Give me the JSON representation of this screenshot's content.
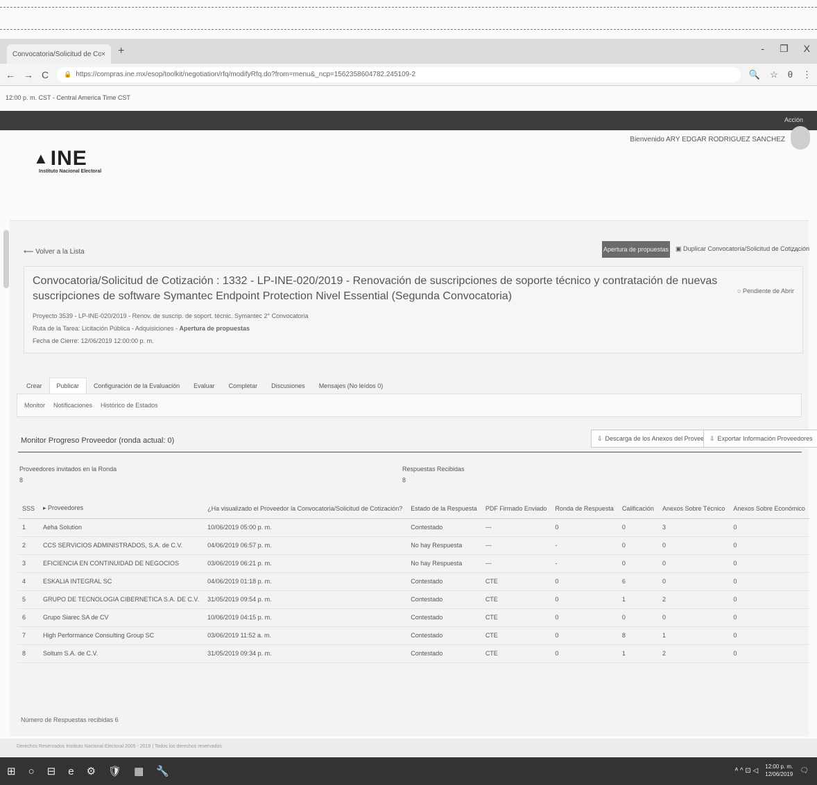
{
  "browser": {
    "tab_title": "Convocatoria/Solicitud de Coti",
    "close_glyph": "×",
    "new_tab_glyph": "+",
    "window_controls": [
      "-",
      "❐",
      "X"
    ],
    "back_glyph": "←",
    "forward_glyph": "→",
    "reload_glyph": "C",
    "lock_glyph": "🔒",
    "url": "https://compras.ine.mx/esop/toolkit/negotiation/rfq/modifyRfq.do?from=menu&_ncp=1562358604782.245109-2",
    "right_icons": [
      "🔍",
      "☆",
      "θ",
      "⋮"
    ]
  },
  "site": {
    "timezone": "12:00 p. m. CST - Central America Time CST",
    "darkbar_right": "Acción",
    "welcome": "Bienvenido ARY EDGAR RODRIGUEZ SANCHEZ",
    "logo_text": "INE",
    "logo_symbol": "▲",
    "logo_sub": "Instituto Nacional Electoral",
    "back_link": "Volver a la Lista",
    "back_glyph": "⟵",
    "btn_open": "Apertura de propuestas",
    "btn_duplicate": "Duplicar Convocatoria/Solicitud de Cotización",
    "btn_more": "...",
    "title": "Convocatoria/Solicitud de Cotización : 1332 - LP-INE-020/2019 - Renovación de suscripciones de soporte técnico y contratación de nuevas suscripciones de software Symantec Endpoint Protection Nivel Essential (Segunda Convocatoria)",
    "status": "Pendiente de Abrir",
    "meta1": "Proyecto 3539 - LP-INE-020/2019 - Renov. de suscrip. de soport. técnic. Symantec 2° Convocatoria",
    "meta2_label": "Ruta de la Tarea: Licitación Pública - Adquisiciones - ",
    "meta2_value": "Apertura de propuestas",
    "meta3": "Fecha de Cierre: 12/06/2019 12:00:00 p. m.",
    "tabs": [
      "Crear",
      "Publicar",
      "Configuración de la Evaluación",
      "Evaluar",
      "Completar",
      "Discusiones",
      "Mensajes (No leídos 0)"
    ],
    "subtabs": [
      "Monitor",
      "Notificaciones",
      "Histórico de Estados"
    ],
    "section_title": "Monitor Progreso Proveedor (ronda actual: 0)",
    "btn_download": "Descarga de los Anexos del Proveedor",
    "btn_export": "Exportar Información Proveedores",
    "invited_label": "Proveedores invitados en la Ronda",
    "invited_count": "8",
    "received_label": "Respuestas Recibidas",
    "received_count": "8",
    "footnote": "Número de Respuestas recibidas 6",
    "footer_text": "Derechos Reservados Instituto Nacional Electoral 2005 - 2019 | Todos los derechos reservados"
  },
  "table": {
    "headers": [
      "SSS",
      "▸ Proveedores",
      "¿Ha visualizado el Proveedor la Convocatoria/Solicitud de Cotización?",
      "Estado de la Respuesta",
      "PDF Firmado Enviado",
      "Ronda de Respuesta",
      "Calificación",
      "Anexos Sobre Técnico",
      "Anexos Sobre Económico"
    ],
    "rows": [
      [
        "1",
        "Aeha Solution",
        "10/06/2019 05:00 p. m.",
        "Contestado",
        "---",
        "0",
        "0",
        "3",
        "0"
      ],
      [
        "2",
        "CCS SERVICIOS ADMINISTRADOS, S.A. de C.V.",
        "04/06/2019 06:57 p. m.",
        "No hay Respuesta",
        "---",
        "-",
        "0",
        "0",
        "0"
      ],
      [
        "3",
        "EFICIENCIA EN CONTINUIDAD DE NEGOCIOS",
        "03/06/2019 06:21 p. m.",
        "No hay Respuesta",
        "---",
        "-",
        "0",
        "0",
        "0"
      ],
      [
        "4",
        "ESKALIA INTEGRAL SC",
        "04/06/2019 01:18 p. m.",
        "Contestado",
        "CTE",
        "0",
        "6",
        "0",
        "0"
      ],
      [
        "5",
        "GRUPO DE TECNOLOGIA CIBERNETICA S.A. DE C.V.",
        "31/05/2019 09:54 p. m.",
        "Contestado",
        "CTE",
        "0",
        "1",
        "2",
        "0"
      ],
      [
        "6",
        "Grupo Siarec SA de CV",
        "10/06/2019 04:15 p. m.",
        "Contestado",
        "CTE",
        "0",
        "0",
        "0",
        "0"
      ],
      [
        "7",
        "High Performance Consulting Group SC",
        "03/06/2019 11:52 a. m.",
        "Contestado",
        "CTE",
        "0",
        "8",
        "1",
        "0"
      ],
      [
        "8",
        "Soltum S.A. de C.V.",
        "31/05/2019 09:34 p. m.",
        "Contestado",
        "CTE",
        "0",
        "1",
        "2",
        "0"
      ]
    ]
  },
  "taskbar": {
    "icons": [
      "⊞",
      "○",
      "⊟",
      "e",
      "⚙",
      "🛡",
      "▦",
      "🔧"
    ],
    "tray": "ᴬ ^ ⊡ ◁",
    "time": "12:00 p. m.",
    "date": "12/06/2019",
    "notif_glyph": "🗨"
  }
}
